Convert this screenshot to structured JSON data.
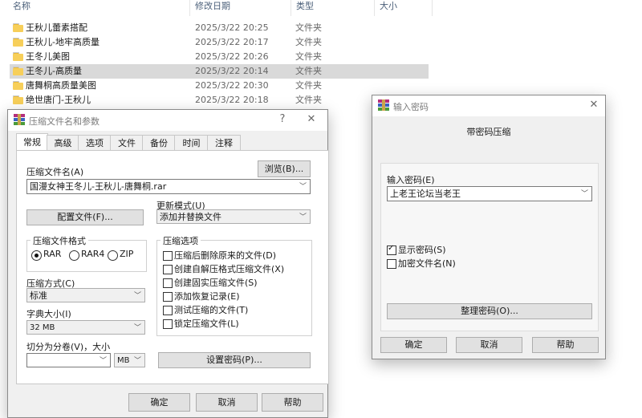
{
  "explorer": {
    "columns": {
      "name": "名称",
      "date": "修改日期",
      "type": "类型",
      "size": "大小"
    },
    "rows": [
      {
        "name": "王秋儿蕾素搭配",
        "date": "2025/3/22 20:25",
        "type": "文件夹"
      },
      {
        "name": "王秋儿-地牢高质量",
        "date": "2025/3/22 20:17",
        "type": "文件夹"
      },
      {
        "name": "王冬儿美图",
        "date": "2025/3/22 20:26",
        "type": "文件夹"
      },
      {
        "name": "王冬儿-高质量",
        "date": "2025/3/22 20:14",
        "type": "文件夹"
      },
      {
        "name": "唐舞桐高质量美图",
        "date": "2025/3/22 20:30",
        "type": "文件夹"
      },
      {
        "name": "绝世唐门-王秋儿",
        "date": "2025/3/22 20:18",
        "type": "文件夹"
      }
    ]
  },
  "archive_dialog": {
    "title": "压缩文件名和参数",
    "help_glyph": "?",
    "close_glyph": "✕",
    "tabs": [
      "常规",
      "高级",
      "选项",
      "文件",
      "备份",
      "时间",
      "注释"
    ],
    "archive_name_label": "压缩文件名(A)",
    "browse_label": "浏览(B)...",
    "archive_name_value": "国漫女神王冬儿-王秋儿-唐舞桐.rar",
    "profiles_label": "配置文件(F)...",
    "update_mode_label": "更新模式(U)",
    "update_mode_value": "添加并替换文件",
    "format_label": "压缩文件格式",
    "formats": [
      "RAR",
      "RAR4",
      "ZIP"
    ],
    "options_label": "压缩选项",
    "options": [
      "压缩后删除原来的文件(D)",
      "创建自解压格式压缩文件(X)",
      "创建固实压缩文件(S)",
      "添加恢复记录(E)",
      "测试压缩的文件(T)",
      "锁定压缩文件(L)"
    ],
    "method_label": "压缩方式(C)",
    "method_value": "标准",
    "dict_label": "字典大小(I)",
    "dict_value": "32 MB",
    "split_label": "切分为分卷(V)，大小",
    "split_value": "",
    "split_unit": "MB",
    "set_password_label": "设置密码(P)...",
    "ok_label": "确定",
    "cancel_label": "取消",
    "help_label": "帮助"
  },
  "password_dialog": {
    "title": "输入密码",
    "close_glyph": "✕",
    "heading": "带密码压缩",
    "enter_label": "输入密码(E)",
    "password_value": "上老王论坛当老王",
    "show_password_label": "显示密码(S)",
    "show_password_checked": true,
    "encrypt_names_label": "加密文件名(N)",
    "encrypt_names_checked": false,
    "organize_label": "整理密码(O)...",
    "ok_label": "确定",
    "cancel_label": "取消",
    "help_label": "帮助"
  }
}
